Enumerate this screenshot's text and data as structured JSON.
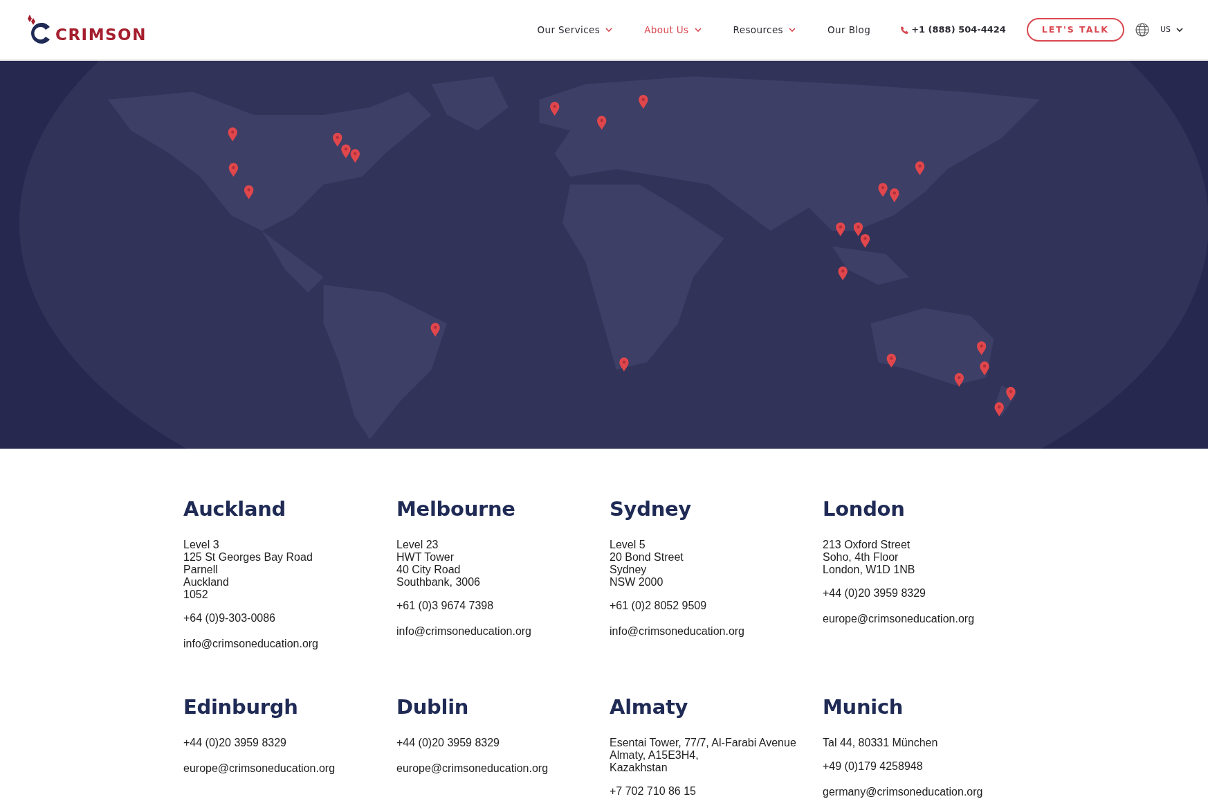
{
  "header": {
    "logo": "CRIMSON",
    "nav": [
      {
        "label": "Our Services",
        "selected": false,
        "dropdown": true
      },
      {
        "label": "About Us",
        "selected": true,
        "dropdown": true
      },
      {
        "label": "Resources",
        "selected": false,
        "dropdown": true
      },
      {
        "label": "Our Blog",
        "selected": false,
        "dropdown": false
      }
    ],
    "phone": "+1 (888) 504-4424",
    "cta": "LET'S TALK",
    "locale": "US"
  },
  "offices": [
    {
      "city": "Auckland",
      "address": [
        "Level 3",
        "125 St Georges Bay Road",
        "Parnell",
        "Auckland",
        "1052"
      ],
      "phone": "+64 (0)9-303-0086",
      "email": "info@crimsoneducation.org"
    },
    {
      "city": "Melbourne",
      "address": [
        "Level 23",
        "HWT Tower",
        "40 City Road",
        "Southbank, 3006"
      ],
      "phone": "+61 (0)3 9674 7398",
      "email": "info@crimsoneducation.org"
    },
    {
      "city": "Sydney",
      "address": [
        "Level 5",
        "20 Bond Street",
        "Sydney",
        "NSW 2000"
      ],
      "phone": "+61 (0)2 8052 9509",
      "email": "info@crimsoneducation.org"
    },
    {
      "city": "London",
      "address": [
        "213 Oxford Street",
        "Soho, 4th Floor",
        "London, W1D 1NB"
      ],
      "phone": "+44 (0)20 3959 8329",
      "email": "europe@crimsoneducation.org"
    },
    {
      "city": "Edinburgh",
      "phone": "+44 (0)20 3959 8329",
      "email": "europe@crimsoneducation.org"
    },
    {
      "city": "Dublin",
      "phone": "+44 (0)20 3959 8329",
      "email": "europe@crimsoneducation.org"
    },
    {
      "city": "Almaty",
      "address": [
        "Esentai Tower, 77/7, Al-Farabi Avenue",
        "Almaty, A15E3H4,",
        "Kazakhstan"
      ],
      "phone": "+7 702 710 86 15"
    },
    {
      "city": "Munich",
      "address": [
        "Tal 44, 80331 München"
      ],
      "phone": "+49 (0)179 4258948",
      "email": "germany@crimsoneducation.org"
    }
  ]
}
